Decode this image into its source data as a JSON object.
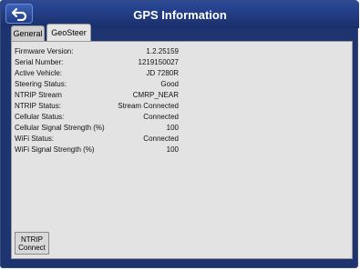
{
  "header": {
    "title": "GPS Information"
  },
  "tabs": [
    {
      "label": "General"
    },
    {
      "label": "GeoSteer"
    }
  ],
  "fields": [
    {
      "label": "Firmware Version:",
      "value": "1.2.25159"
    },
    {
      "label": "Serial Number:",
      "value": "1219150027"
    },
    {
      "label": "Active Vehicle:",
      "value": "JD 7280R"
    },
    {
      "label": "Steering Status:",
      "value": "Good"
    },
    {
      "label": "NTRIP Stream",
      "value": "CMRP_NEAR"
    },
    {
      "label": "NTRIP Status:",
      "value": "Stream Connected"
    },
    {
      "label": "Cellular Status:",
      "value": "Connected"
    },
    {
      "label": "Cellular Signal Strength (%)",
      "value": "100"
    },
    {
      "label": "WiFi Status:",
      "value": "Connected"
    },
    {
      "label": "WiFi Signal Strength (%)",
      "value": "100"
    }
  ],
  "buttons": {
    "ntrip_connect_line1": "NTRIP",
    "ntrip_connect_line2": "Connect"
  },
  "colors": {
    "titlebar": "#1e3470",
    "panel": "#e3e3e3"
  },
  "icons": {
    "back": "back-arrow-icon"
  }
}
